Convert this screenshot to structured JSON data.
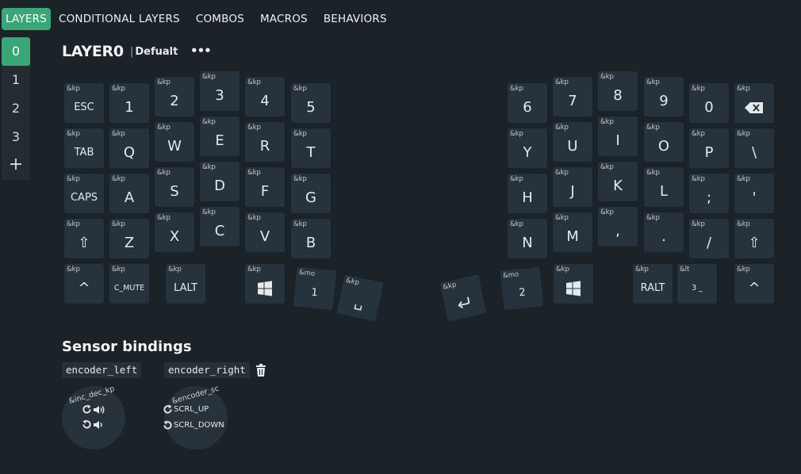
{
  "nav": {
    "tabs": [
      "LAYERS",
      "CONDITIONAL LAYERS",
      "COMBOS",
      "MACROS",
      "BEHAVIORS"
    ]
  },
  "layers": {
    "items": [
      "0",
      "1",
      "2",
      "3"
    ],
    "add_label": "+"
  },
  "layer_header": {
    "title": "LAYER0",
    "name": "Defualt",
    "more_label": "•••"
  },
  "keys": {
    "esc": {
      "binding": "&kp",
      "label": "ESC"
    },
    "n1": {
      "binding": "&kp",
      "label": "1"
    },
    "n2": {
      "binding": "&kp",
      "label": "2"
    },
    "n3": {
      "binding": "&kp",
      "label": "3"
    },
    "n4": {
      "binding": "&kp",
      "label": "4"
    },
    "n5": {
      "binding": "&kp",
      "label": "5"
    },
    "tab": {
      "binding": "&kp",
      "label": "TAB"
    },
    "q": {
      "binding": "&kp",
      "label": "Q"
    },
    "w": {
      "binding": "&kp",
      "label": "W"
    },
    "e": {
      "binding": "&kp",
      "label": "E"
    },
    "r": {
      "binding": "&kp",
      "label": "R"
    },
    "t": {
      "binding": "&kp",
      "label": "T"
    },
    "caps": {
      "binding": "&kp",
      "label": "CAPS"
    },
    "a": {
      "binding": "&kp",
      "label": "A"
    },
    "s": {
      "binding": "&kp",
      "label": "S"
    },
    "d": {
      "binding": "&kp",
      "label": "D"
    },
    "f": {
      "binding": "&kp",
      "label": "F"
    },
    "g": {
      "binding": "&kp",
      "label": "G"
    },
    "lshift": {
      "binding": "&kp",
      "label": "⇧"
    },
    "z": {
      "binding": "&kp",
      "label": "Z"
    },
    "x": {
      "binding": "&kp",
      "label": "X"
    },
    "c": {
      "binding": "&kp",
      "label": "C"
    },
    "v": {
      "binding": "&kp",
      "label": "V"
    },
    "b": {
      "binding": "&kp",
      "label": "B"
    },
    "lcaret": {
      "binding": "&kp",
      "label": "^"
    },
    "cmute": {
      "binding": "&kp",
      "label": "C_MUTE"
    },
    "lalt": {
      "binding": "&kp",
      "label": "LALT"
    },
    "lgui": {
      "binding": "&kp",
      "icon": "windows-logo-icon"
    },
    "mo1": {
      "binding": "&mo",
      "label": "1"
    },
    "space": {
      "binding": "&kp",
      "label": "␣"
    },
    "enter": {
      "binding": "&kp",
      "icon": "enter-arrow-icon"
    },
    "mo2": {
      "binding": "&mo",
      "label": "2"
    },
    "rgui": {
      "binding": "&kp",
      "icon": "windows-logo-icon"
    },
    "n6": {
      "binding": "&kp",
      "label": "6"
    },
    "n7": {
      "binding": "&kp",
      "label": "7"
    },
    "n8": {
      "binding": "&kp",
      "label": "8"
    },
    "n9": {
      "binding": "&kp",
      "label": "9"
    },
    "n0": {
      "binding": "&kp",
      "label": "0"
    },
    "bspc": {
      "binding": "&kp",
      "icon": "backspace-icon"
    },
    "y": {
      "binding": "&kp",
      "label": "Y"
    },
    "u": {
      "binding": "&kp",
      "label": "U"
    },
    "i": {
      "binding": "&kp",
      "label": "I"
    },
    "o": {
      "binding": "&kp",
      "label": "O"
    },
    "p": {
      "binding": "&kp",
      "label": "P"
    },
    "bslh": {
      "binding": "&kp",
      "label": "\\"
    },
    "h": {
      "binding": "&kp",
      "label": "H"
    },
    "j": {
      "binding": "&kp",
      "label": "J"
    },
    "k": {
      "binding": "&kp",
      "label": "K"
    },
    "l": {
      "binding": "&kp",
      "label": "L"
    },
    "semi": {
      "binding": "&kp",
      "label": ";"
    },
    "sqt": {
      "binding": "&kp",
      "label": "'"
    },
    "n": {
      "binding": "&kp",
      "label": "N"
    },
    "m": {
      "binding": "&kp",
      "label": "M"
    },
    "comma": {
      "binding": "&kp",
      "label": ","
    },
    "dot": {
      "binding": "&kp",
      "label": "."
    },
    "fslh": {
      "binding": "&kp",
      "label": "/"
    },
    "rshift": {
      "binding": "&kp",
      "label": "⇧"
    },
    "ralt": {
      "binding": "&kp",
      "label": "RALT"
    },
    "lt3": {
      "binding": "&lt",
      "label": "3 _"
    },
    "rcaret": {
      "binding": "&kp",
      "label": "^"
    }
  },
  "sensors": {
    "title": "Sensor bindings",
    "left": {
      "label": "encoder_left",
      "behavior": "&inc_dec_kp",
      "cw_icon": "volume-up-icon",
      "ccw_icon": "volume-down-icon"
    },
    "right": {
      "label": "encoder_right",
      "behavior": "&encoder_sc",
      "cw_label": "SCRL_UP",
      "ccw_label": "SCRL_DOWN"
    }
  }
}
